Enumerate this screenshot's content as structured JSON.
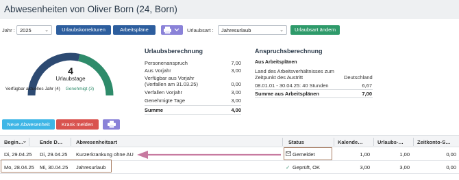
{
  "header": {
    "title": "Abwesenheiten von Oliver Born (24, Born)"
  },
  "toolbar": {
    "year_label": "Jahr :",
    "year_value": "2025",
    "btn_corrections": "Urlaubskorrekturen",
    "btn_plans": "Arbeitspläne",
    "vacation_type_label": "Urlaubsart :",
    "vacation_type_value": "Jahresurlaub",
    "btn_change_type": "Urlaubsart ändern"
  },
  "gauge": {
    "value": "4",
    "unit": "Urlaubstage",
    "legend_available": "Verfügbar aktuelles Jahr (4)",
    "legend_approved": "Genehmigt (3)",
    "fill_fraction": 0.57,
    "color_used": "#2d4a72",
    "color_approved": "#2e8b6a",
    "color_track": "#dfe3e8"
  },
  "calc": {
    "title": "Urlaubsberechnung",
    "rows": [
      {
        "label": "Personenanspruch",
        "value": "7,00"
      },
      {
        "label": "Aus Vorjahr",
        "value": "3,00"
      },
      {
        "label": "Verfügbar aus Vorjahr",
        "label2": "(Verfallen am 31.03.25)",
        "value": "0,00"
      },
      {
        "label": "Verfallen Vorjahr",
        "value": "3,00"
      },
      {
        "label": "Genehmigte Tage",
        "value": "3,00"
      }
    ],
    "sum_label": "Summe",
    "sum_value": "4,00"
  },
  "claim": {
    "title": "Anspruchsberechnung",
    "subtitle": "Aus Arbeitsplänen",
    "line1": "Land des Arbeitsverhältnisses zum",
    "line2": "Zeitpunkt des Austritt",
    "country": "Deutschland",
    "period": "08.01.01 - 30.04.25: 40 Stunden",
    "period_value": "6,67",
    "sum_label": "Summe aus Arbeitsplänen",
    "sum_value": "7,00"
  },
  "actions": {
    "new_absence": "Neue Abwesenheit",
    "sick_report": "Krank melden"
  },
  "table": {
    "columns": [
      "Begin…",
      "Ende D…",
      "Abwesenheitsart",
      "Status",
      "Kalende…",
      "Urlaubs-…",
      "Zeitkonto-S…"
    ],
    "rows": [
      {
        "begin": "Di, 29.04.25",
        "end": "Di, 29.04.25",
        "type": "Kurzerkrankung ohne AU",
        "status": "Gemeldet",
        "status_icon": "envelope-icon",
        "cal": "1,00",
        "vac": "1,00",
        "time": "0,00"
      },
      {
        "begin": "Mo, 28.04.25",
        "end": "Mi, 30.04.25",
        "type": "Jahresurlaub",
        "status": "Geprüft, OK",
        "status_icon": "check-icon",
        "cal": "3,00",
        "vac": "3,00",
        "time": "0,00"
      }
    ]
  },
  "annotation": {
    "arrow_color": "#c77aa0",
    "box_color": "#a87d62"
  }
}
